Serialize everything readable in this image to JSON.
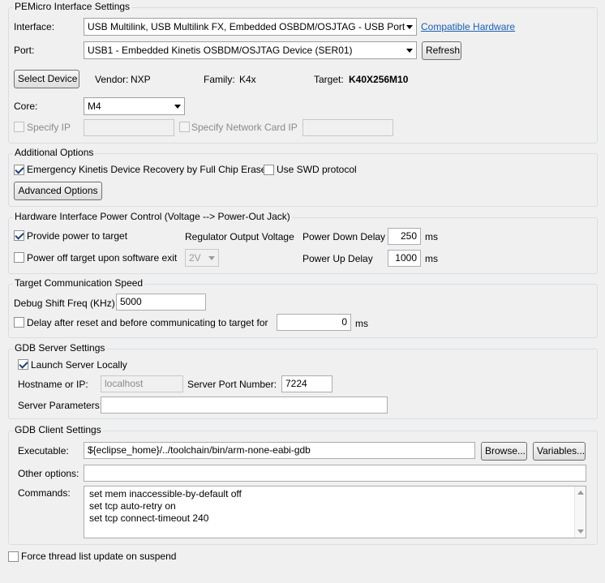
{
  "pemicro": {
    "title": "PEMicro Interface Settings",
    "interface_label": "Interface:",
    "interface_value": "USB Multilink, USB Multilink FX, Embedded OSBDM/OSJTAG - USB Port",
    "compatible_link": "Compatible Hardware",
    "port_label": "Port:",
    "port_value": "USB1 - Embedded Kinetis OSBDM/OSJTAG Device (SER01)",
    "refresh_button": "Refresh",
    "select_device_button": "Select Device",
    "vendor_label": "Vendor:",
    "vendor_value": "NXP",
    "family_label": "Family:",
    "family_value": "K4x",
    "target_label": "Target:",
    "target_value": "K40X256M10",
    "core_label": "Core:",
    "core_value": "M4",
    "specify_ip_label": "Specify IP",
    "specify_ip_value": "",
    "specify_network_label": "Specify Network Card IP",
    "specify_network_value": ""
  },
  "additional": {
    "title": "Additional Options",
    "emergency_label": "Emergency Kinetis Device Recovery by Full Chip Erase",
    "emergency_checked": true,
    "swd_label": "Use SWD protocol",
    "swd_checked": false,
    "advanced_button": "Advanced Options"
  },
  "power": {
    "title": "Hardware Interface Power Control (Voltage --> Power-Out Jack)",
    "provide_label": "Provide power to target",
    "provide_checked": true,
    "regulator_label": "Regulator Output Voltage",
    "power_down_label": "Power Down Delay",
    "power_down_value": "250",
    "power_down_unit": "ms",
    "power_off_label": "Power off target upon software exit",
    "power_off_checked": false,
    "voltage_value": "2V",
    "power_up_label": "Power Up Delay",
    "power_up_value": "1000",
    "power_up_unit": "ms"
  },
  "speed": {
    "title": "Target Communication Speed",
    "shift_label": "Debug Shift Freq (KHz)",
    "shift_value": "5000",
    "delay_label": "Delay after reset and before communicating to target for",
    "delay_checked": false,
    "delay_value": "0",
    "delay_unit": "ms"
  },
  "gdb_server": {
    "title": "GDB Server Settings",
    "launch_label": "Launch Server Locally",
    "launch_checked": true,
    "hostname_label": "Hostname or IP:",
    "hostname_value": "localhost",
    "port_label": "Server Port Number:",
    "port_value": "7224",
    "params_label": "Server Parameters:",
    "params_value": ""
  },
  "gdb_client": {
    "title": "GDB Client Settings",
    "exec_label": "Executable:",
    "exec_value": "${eclipse_home}/../toolchain/bin/arm-none-eabi-gdb",
    "browse_button": "Browse...",
    "variables_button": "Variables...",
    "other_label": "Other options:",
    "other_value": "",
    "commands_label": "Commands:",
    "commands": [
      "set mem inaccessible-by-default off",
      "set tcp auto-retry on",
      "set tcp connect-timeout 240"
    ]
  },
  "footer": {
    "force_label": "Force thread list update on suspend",
    "force_checked": false
  }
}
